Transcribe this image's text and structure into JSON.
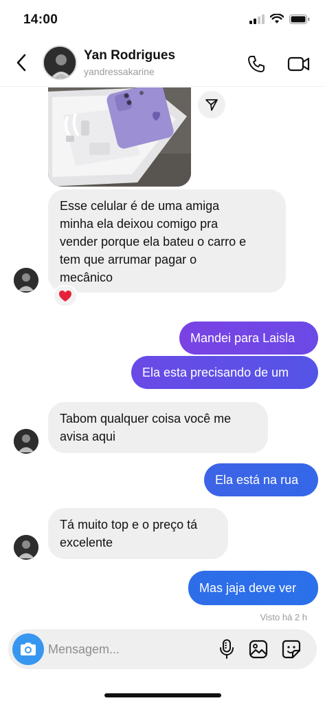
{
  "status_bar": {
    "time": "14:00"
  },
  "header": {
    "name": "Yan Rodrigues",
    "username": "yandressakarine"
  },
  "messages": [
    {
      "side": "in",
      "type": "image"
    },
    {
      "side": "in",
      "text": "Esse celular é de uma amiga\nminha ela deixou comigo pra\nvender porque ela bateu o carro e\ntem que arrumar pagar o\nmecânico",
      "reaction": "heart"
    },
    {
      "side": "out",
      "text": "Mandei para Laisla"
    },
    {
      "side": "out",
      "text": "Ela esta precisando de um"
    },
    {
      "side": "in",
      "text": "Tabom qualquer coisa você me\navisa aqui"
    },
    {
      "side": "out",
      "text": "Ela está na rua"
    },
    {
      "side": "in",
      "text": "Tá muito top e o preço tá\nexcelente"
    },
    {
      "side": "out",
      "text": "Mas jaja deve ver"
    }
  ],
  "seen_status": "Visto há 2 h",
  "composer": {
    "placeholder": "Mensagem..."
  },
  "colors": {
    "outgoing_gradient": [
      "#7b3fe4",
      "#2f6fe8"
    ],
    "incoming_bubble": "#efefef",
    "camera_button": "#3797f0"
  }
}
